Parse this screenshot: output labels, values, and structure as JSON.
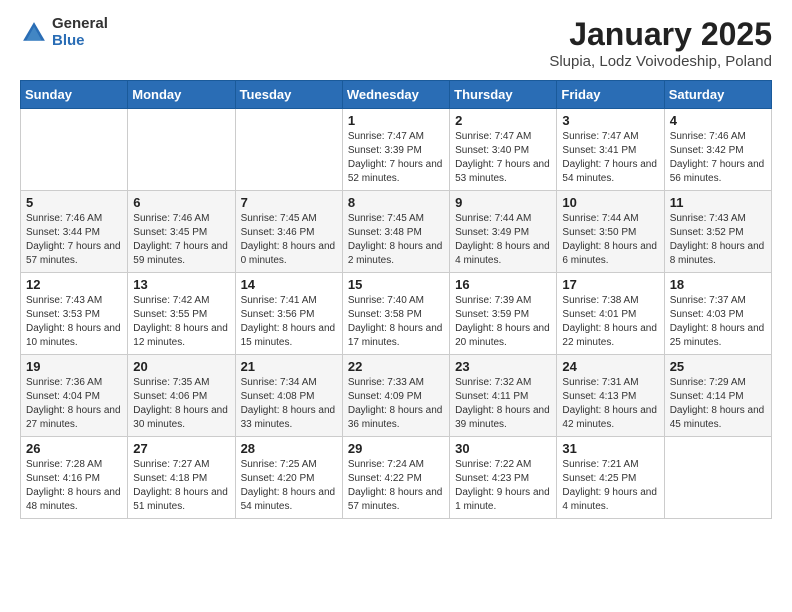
{
  "logo": {
    "general": "General",
    "blue": "Blue"
  },
  "title": "January 2025",
  "subtitle": "Slupia, Lodz Voivodeship, Poland",
  "days_of_week": [
    "Sunday",
    "Monday",
    "Tuesday",
    "Wednesday",
    "Thursday",
    "Friday",
    "Saturday"
  ],
  "weeks": [
    [
      {
        "day": "",
        "info": ""
      },
      {
        "day": "",
        "info": ""
      },
      {
        "day": "",
        "info": ""
      },
      {
        "day": "1",
        "info": "Sunrise: 7:47 AM\nSunset: 3:39 PM\nDaylight: 7 hours and 52 minutes."
      },
      {
        "day": "2",
        "info": "Sunrise: 7:47 AM\nSunset: 3:40 PM\nDaylight: 7 hours and 53 minutes."
      },
      {
        "day": "3",
        "info": "Sunrise: 7:47 AM\nSunset: 3:41 PM\nDaylight: 7 hours and 54 minutes."
      },
      {
        "day": "4",
        "info": "Sunrise: 7:46 AM\nSunset: 3:42 PM\nDaylight: 7 hours and 56 minutes."
      }
    ],
    [
      {
        "day": "5",
        "info": "Sunrise: 7:46 AM\nSunset: 3:44 PM\nDaylight: 7 hours and 57 minutes."
      },
      {
        "day": "6",
        "info": "Sunrise: 7:46 AM\nSunset: 3:45 PM\nDaylight: 7 hours and 59 minutes."
      },
      {
        "day": "7",
        "info": "Sunrise: 7:45 AM\nSunset: 3:46 PM\nDaylight: 8 hours and 0 minutes."
      },
      {
        "day": "8",
        "info": "Sunrise: 7:45 AM\nSunset: 3:48 PM\nDaylight: 8 hours and 2 minutes."
      },
      {
        "day": "9",
        "info": "Sunrise: 7:44 AM\nSunset: 3:49 PM\nDaylight: 8 hours and 4 minutes."
      },
      {
        "day": "10",
        "info": "Sunrise: 7:44 AM\nSunset: 3:50 PM\nDaylight: 8 hours and 6 minutes."
      },
      {
        "day": "11",
        "info": "Sunrise: 7:43 AM\nSunset: 3:52 PM\nDaylight: 8 hours and 8 minutes."
      }
    ],
    [
      {
        "day": "12",
        "info": "Sunrise: 7:43 AM\nSunset: 3:53 PM\nDaylight: 8 hours and 10 minutes."
      },
      {
        "day": "13",
        "info": "Sunrise: 7:42 AM\nSunset: 3:55 PM\nDaylight: 8 hours and 12 minutes."
      },
      {
        "day": "14",
        "info": "Sunrise: 7:41 AM\nSunset: 3:56 PM\nDaylight: 8 hours and 15 minutes."
      },
      {
        "day": "15",
        "info": "Sunrise: 7:40 AM\nSunset: 3:58 PM\nDaylight: 8 hours and 17 minutes."
      },
      {
        "day": "16",
        "info": "Sunrise: 7:39 AM\nSunset: 3:59 PM\nDaylight: 8 hours and 20 minutes."
      },
      {
        "day": "17",
        "info": "Sunrise: 7:38 AM\nSunset: 4:01 PM\nDaylight: 8 hours and 22 minutes."
      },
      {
        "day": "18",
        "info": "Sunrise: 7:37 AM\nSunset: 4:03 PM\nDaylight: 8 hours and 25 minutes."
      }
    ],
    [
      {
        "day": "19",
        "info": "Sunrise: 7:36 AM\nSunset: 4:04 PM\nDaylight: 8 hours and 27 minutes."
      },
      {
        "day": "20",
        "info": "Sunrise: 7:35 AM\nSunset: 4:06 PM\nDaylight: 8 hours and 30 minutes."
      },
      {
        "day": "21",
        "info": "Sunrise: 7:34 AM\nSunset: 4:08 PM\nDaylight: 8 hours and 33 minutes."
      },
      {
        "day": "22",
        "info": "Sunrise: 7:33 AM\nSunset: 4:09 PM\nDaylight: 8 hours and 36 minutes."
      },
      {
        "day": "23",
        "info": "Sunrise: 7:32 AM\nSunset: 4:11 PM\nDaylight: 8 hours and 39 minutes."
      },
      {
        "day": "24",
        "info": "Sunrise: 7:31 AM\nSunset: 4:13 PM\nDaylight: 8 hours and 42 minutes."
      },
      {
        "day": "25",
        "info": "Sunrise: 7:29 AM\nSunset: 4:14 PM\nDaylight: 8 hours and 45 minutes."
      }
    ],
    [
      {
        "day": "26",
        "info": "Sunrise: 7:28 AM\nSunset: 4:16 PM\nDaylight: 8 hours and 48 minutes."
      },
      {
        "day": "27",
        "info": "Sunrise: 7:27 AM\nSunset: 4:18 PM\nDaylight: 8 hours and 51 minutes."
      },
      {
        "day": "28",
        "info": "Sunrise: 7:25 AM\nSunset: 4:20 PM\nDaylight: 8 hours and 54 minutes."
      },
      {
        "day": "29",
        "info": "Sunrise: 7:24 AM\nSunset: 4:22 PM\nDaylight: 8 hours and 57 minutes."
      },
      {
        "day": "30",
        "info": "Sunrise: 7:22 AM\nSunset: 4:23 PM\nDaylight: 9 hours and 1 minute."
      },
      {
        "day": "31",
        "info": "Sunrise: 7:21 AM\nSunset: 4:25 PM\nDaylight: 9 hours and 4 minutes."
      },
      {
        "day": "",
        "info": ""
      }
    ]
  ]
}
